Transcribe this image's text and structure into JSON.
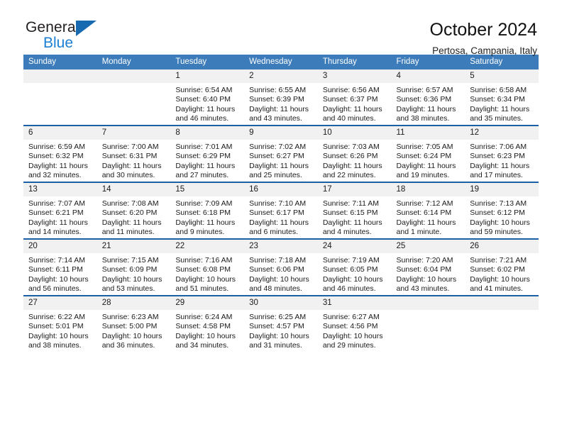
{
  "brand": {
    "name_top": "General",
    "name_bottom": "Blue",
    "triangle_color": "#1769b0",
    "blue_color": "#1b7fd4"
  },
  "header": {
    "title": "October 2024",
    "subtitle": "Pertosa, Campania, Italy"
  },
  "theme": {
    "header_row_bg": "#3c7cba",
    "row_border": "#1c61a4",
    "daynum_bg": "#f1f1f1"
  },
  "calendar": {
    "weekday_headers": [
      "Sunday",
      "Monday",
      "Tuesday",
      "Wednesday",
      "Thursday",
      "Friday",
      "Saturday"
    ],
    "labels": {
      "sunrise": "Sunrise:",
      "sunset": "Sunset:",
      "daylight": "Daylight:"
    },
    "weeks": [
      [
        {
          "day": "",
          "empty": true
        },
        {
          "day": "",
          "empty": true
        },
        {
          "day": "1",
          "sunrise": "Sunrise: 6:54 AM",
          "sunset": "Sunset: 6:40 PM",
          "daylight": "Daylight: 11 hours and 46 minutes."
        },
        {
          "day": "2",
          "sunrise": "Sunrise: 6:55 AM",
          "sunset": "Sunset: 6:39 PM",
          "daylight": "Daylight: 11 hours and 43 minutes."
        },
        {
          "day": "3",
          "sunrise": "Sunrise: 6:56 AM",
          "sunset": "Sunset: 6:37 PM",
          "daylight": "Daylight: 11 hours and 40 minutes."
        },
        {
          "day": "4",
          "sunrise": "Sunrise: 6:57 AM",
          "sunset": "Sunset: 6:36 PM",
          "daylight": "Daylight: 11 hours and 38 minutes."
        },
        {
          "day": "5",
          "sunrise": "Sunrise: 6:58 AM",
          "sunset": "Sunset: 6:34 PM",
          "daylight": "Daylight: 11 hours and 35 minutes."
        }
      ],
      [
        {
          "day": "6",
          "sunrise": "Sunrise: 6:59 AM",
          "sunset": "Sunset: 6:32 PM",
          "daylight": "Daylight: 11 hours and 32 minutes."
        },
        {
          "day": "7",
          "sunrise": "Sunrise: 7:00 AM",
          "sunset": "Sunset: 6:31 PM",
          "daylight": "Daylight: 11 hours and 30 minutes."
        },
        {
          "day": "8",
          "sunrise": "Sunrise: 7:01 AM",
          "sunset": "Sunset: 6:29 PM",
          "daylight": "Daylight: 11 hours and 27 minutes."
        },
        {
          "day": "9",
          "sunrise": "Sunrise: 7:02 AM",
          "sunset": "Sunset: 6:27 PM",
          "daylight": "Daylight: 11 hours and 25 minutes."
        },
        {
          "day": "10",
          "sunrise": "Sunrise: 7:03 AM",
          "sunset": "Sunset: 6:26 PM",
          "daylight": "Daylight: 11 hours and 22 minutes."
        },
        {
          "day": "11",
          "sunrise": "Sunrise: 7:05 AM",
          "sunset": "Sunset: 6:24 PM",
          "daylight": "Daylight: 11 hours and 19 minutes."
        },
        {
          "day": "12",
          "sunrise": "Sunrise: 7:06 AM",
          "sunset": "Sunset: 6:23 PM",
          "daylight": "Daylight: 11 hours and 17 minutes."
        }
      ],
      [
        {
          "day": "13",
          "sunrise": "Sunrise: 7:07 AM",
          "sunset": "Sunset: 6:21 PM",
          "daylight": "Daylight: 11 hours and 14 minutes."
        },
        {
          "day": "14",
          "sunrise": "Sunrise: 7:08 AM",
          "sunset": "Sunset: 6:20 PM",
          "daylight": "Daylight: 11 hours and 11 minutes."
        },
        {
          "day": "15",
          "sunrise": "Sunrise: 7:09 AM",
          "sunset": "Sunset: 6:18 PM",
          "daylight": "Daylight: 11 hours and 9 minutes."
        },
        {
          "day": "16",
          "sunrise": "Sunrise: 7:10 AM",
          "sunset": "Sunset: 6:17 PM",
          "daylight": "Daylight: 11 hours and 6 minutes."
        },
        {
          "day": "17",
          "sunrise": "Sunrise: 7:11 AM",
          "sunset": "Sunset: 6:15 PM",
          "daylight": "Daylight: 11 hours and 4 minutes."
        },
        {
          "day": "18",
          "sunrise": "Sunrise: 7:12 AM",
          "sunset": "Sunset: 6:14 PM",
          "daylight": "Daylight: 11 hours and 1 minute."
        },
        {
          "day": "19",
          "sunrise": "Sunrise: 7:13 AM",
          "sunset": "Sunset: 6:12 PM",
          "daylight": "Daylight: 10 hours and 59 minutes."
        }
      ],
      [
        {
          "day": "20",
          "sunrise": "Sunrise: 7:14 AM",
          "sunset": "Sunset: 6:11 PM",
          "daylight": "Daylight: 10 hours and 56 minutes."
        },
        {
          "day": "21",
          "sunrise": "Sunrise: 7:15 AM",
          "sunset": "Sunset: 6:09 PM",
          "daylight": "Daylight: 10 hours and 53 minutes."
        },
        {
          "day": "22",
          "sunrise": "Sunrise: 7:16 AM",
          "sunset": "Sunset: 6:08 PM",
          "daylight": "Daylight: 10 hours and 51 minutes."
        },
        {
          "day": "23",
          "sunrise": "Sunrise: 7:18 AM",
          "sunset": "Sunset: 6:06 PM",
          "daylight": "Daylight: 10 hours and 48 minutes."
        },
        {
          "day": "24",
          "sunrise": "Sunrise: 7:19 AM",
          "sunset": "Sunset: 6:05 PM",
          "daylight": "Daylight: 10 hours and 46 minutes."
        },
        {
          "day": "25",
          "sunrise": "Sunrise: 7:20 AM",
          "sunset": "Sunset: 6:04 PM",
          "daylight": "Daylight: 10 hours and 43 minutes."
        },
        {
          "day": "26",
          "sunrise": "Sunrise: 7:21 AM",
          "sunset": "Sunset: 6:02 PM",
          "daylight": "Daylight: 10 hours and 41 minutes."
        }
      ],
      [
        {
          "day": "27",
          "sunrise": "Sunrise: 6:22 AM",
          "sunset": "Sunset: 5:01 PM",
          "daylight": "Daylight: 10 hours and 38 minutes."
        },
        {
          "day": "28",
          "sunrise": "Sunrise: 6:23 AM",
          "sunset": "Sunset: 5:00 PM",
          "daylight": "Daylight: 10 hours and 36 minutes."
        },
        {
          "day": "29",
          "sunrise": "Sunrise: 6:24 AM",
          "sunset": "Sunset: 4:58 PM",
          "daylight": "Daylight: 10 hours and 34 minutes."
        },
        {
          "day": "30",
          "sunrise": "Sunrise: 6:25 AM",
          "sunset": "Sunset: 4:57 PM",
          "daylight": "Daylight: 10 hours and 31 minutes."
        },
        {
          "day": "31",
          "sunrise": "Sunrise: 6:27 AM",
          "sunset": "Sunset: 4:56 PM",
          "daylight": "Daylight: 10 hours and 29 minutes."
        },
        {
          "day": "",
          "empty": true
        },
        {
          "day": "",
          "empty": true
        }
      ]
    ]
  }
}
